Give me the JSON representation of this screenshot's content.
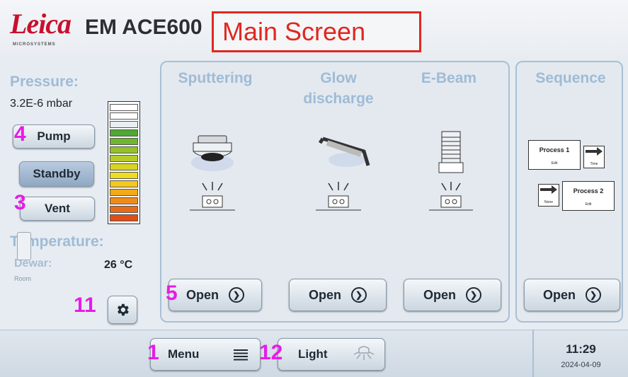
{
  "header": {
    "brand": "Leica",
    "brand_sub": "MICROSYSTEMS",
    "model": "EM ACE600",
    "screen_label": "Main Screen"
  },
  "left_panel": {
    "pressure_label": "Pressure:",
    "pressure_value": "3.2E-6 mbar",
    "pump_label": "Pump",
    "standby_label": "Standby",
    "vent_label": "Vent",
    "temperature_label": "Temperature:",
    "dewar_label": "Dewar:",
    "dewar_value": "26 °C",
    "room_label": "Room",
    "pressure_bar_segments": [
      "#ffffff",
      "#ffffff",
      "#e8eef2",
      "#4fa832",
      "#6eb62e",
      "#93c22b",
      "#b5cc28",
      "#d7d423",
      "#eedc1e",
      "#f4c81c",
      "#f3a91a",
      "#ef8b18",
      "#e86a16",
      "#e04d14"
    ]
  },
  "processes": [
    {
      "title": "Sputtering",
      "open_label": "Open",
      "icon": "sputter-head-icon"
    },
    {
      "title": "Glow discharge",
      "open_label": "Open",
      "icon": "glow-discharge-icon"
    },
    {
      "title": "E-Beam",
      "open_label": "Open",
      "icon": "e-beam-gun-icon"
    }
  ],
  "sequence": {
    "title": "Sequence",
    "open_label": "Open",
    "process1": "Process 1",
    "process2": "Process 2",
    "edit1": "Edit",
    "edit2": "Edit",
    "time_label": "Time",
    "none_label": "None"
  },
  "footer": {
    "menu_label": "Menu",
    "light_label": "Light",
    "time": "11:29",
    "date": "2024-04-09"
  },
  "annotations": {
    "pump": "4",
    "vent": "3",
    "settings": "11",
    "open": "5",
    "menu": "1",
    "light": "12"
  },
  "colors": {
    "annotation": "#e61ce6",
    "frame": "#e0281f",
    "brand": "#c8102e",
    "label": "#9fbbd6"
  }
}
